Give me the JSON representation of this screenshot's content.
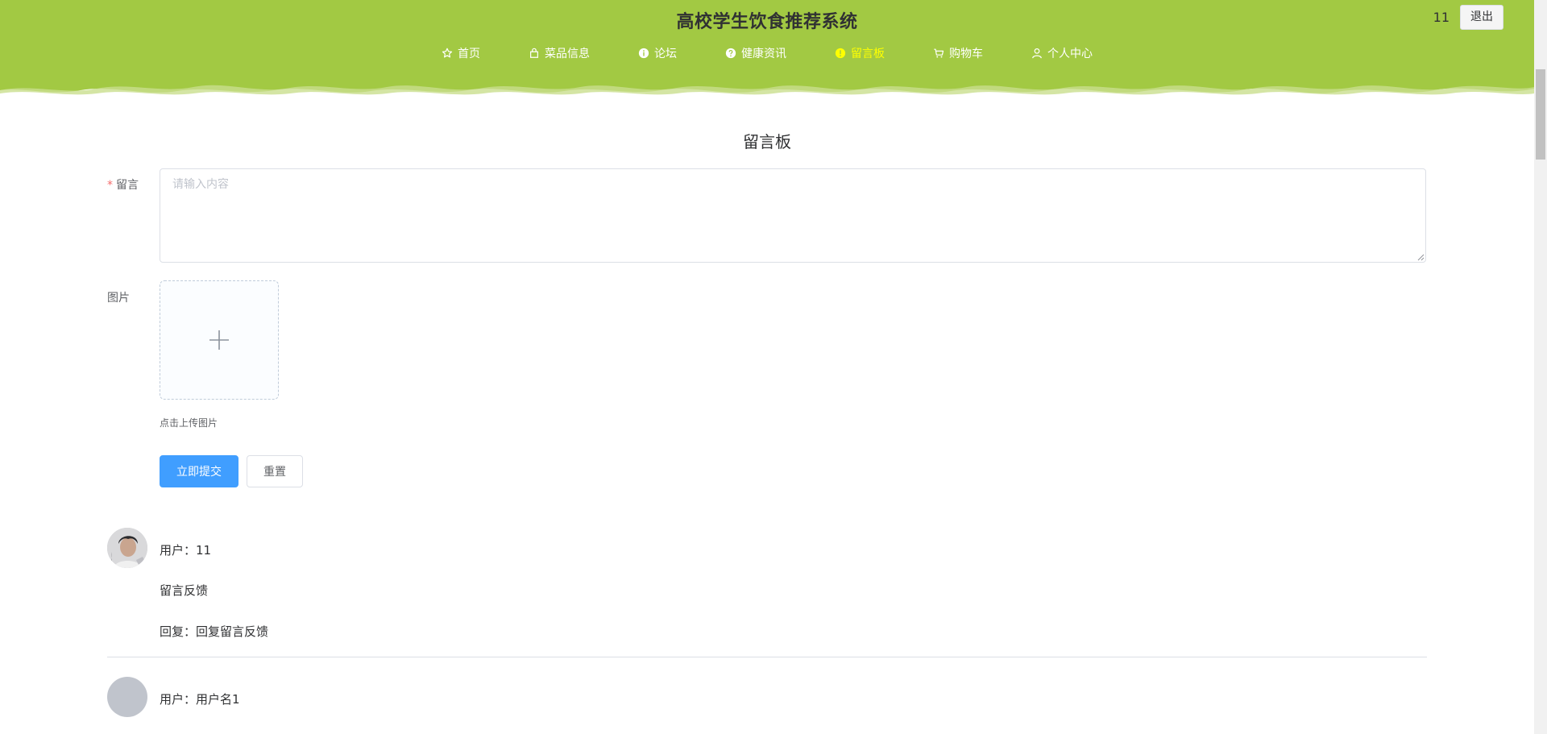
{
  "header": {
    "title": "高校学生饮食推荐系统",
    "username": "11",
    "logout_label": "退出",
    "bg_color": "#a2c943"
  },
  "nav": {
    "items": [
      {
        "label": "首页",
        "icon": "star-icon"
      },
      {
        "label": "菜品信息",
        "icon": "shop-icon"
      },
      {
        "label": "论坛",
        "icon": "info-icon"
      },
      {
        "label": "健康资讯",
        "icon": "question-icon"
      },
      {
        "label": "留言板",
        "icon": "warning-icon",
        "active": true
      },
      {
        "label": "购物车",
        "icon": "cart-icon"
      },
      {
        "label": "个人中心",
        "icon": "user-icon"
      }
    ],
    "active_color": "#ffff00"
  },
  "board": {
    "title": "留言板"
  },
  "form": {
    "message_label": "留言",
    "message_placeholder": "请输入内容",
    "image_label": "图片",
    "upload_tip": "点击上传图片",
    "submit_label": "立即提交",
    "reset_label": "重置"
  },
  "messages": [
    {
      "user": "用户：11",
      "content": "留言反馈",
      "reply": "回复：回复留言反馈",
      "has_photo": true
    },
    {
      "user": "用户：用户名1",
      "content": "",
      "reply": "",
      "has_photo": false
    }
  ]
}
